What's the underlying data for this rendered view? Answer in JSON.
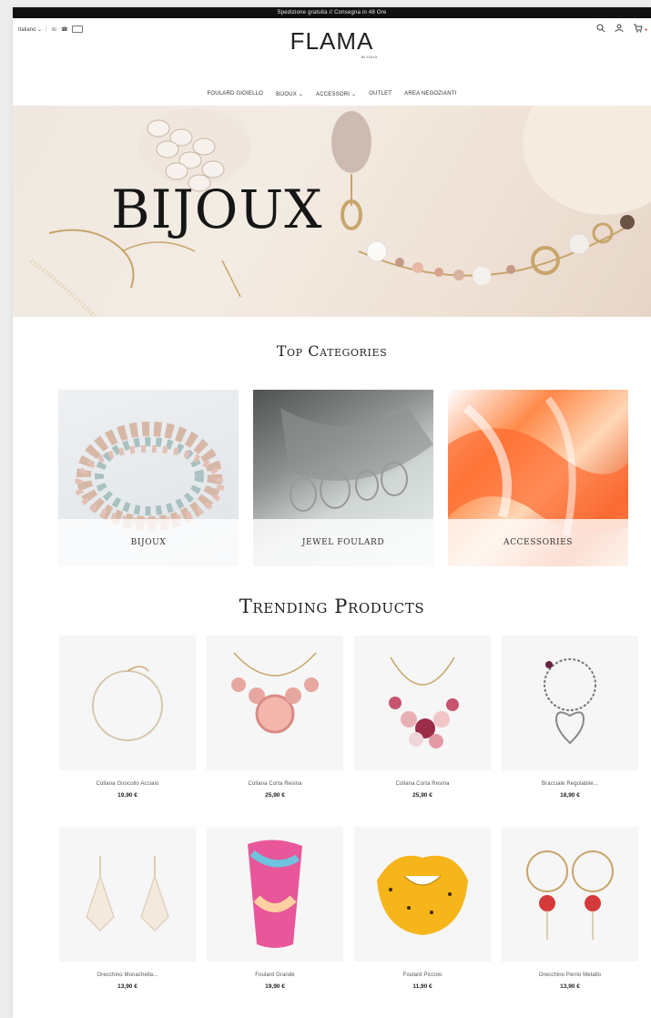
{
  "announcement": "Spedizione gratuita // Consegna in 48 Ore",
  "topbar": {
    "language": "Italiano ⌄"
  },
  "logo": {
    "main": "FLAMA",
    "sub": "BIJOUX"
  },
  "nav": [
    {
      "label": "FOULARD GIOIELLO"
    },
    {
      "label": "BIJOUX ⌄"
    },
    {
      "label": "ACCESSORI ⌄"
    },
    {
      "label": "OUTLET"
    },
    {
      "label": "AREA NEGOZIANTI"
    }
  ],
  "hero": {
    "title": "BIJOUX"
  },
  "sections": {
    "top_categories": "Top Categories",
    "trending": "Trending Products"
  },
  "categories": [
    {
      "label": "BIJOUX"
    },
    {
      "label": "JEWEL FOULARD"
    },
    {
      "label": "ACCESSORIES"
    }
  ],
  "products": [
    {
      "name": "Collana Girocollo Acciaio",
      "price": "19,90 €"
    },
    {
      "name": "Collana Corta Resina",
      "price": "25,90 €"
    },
    {
      "name": "Collana Corta Resina",
      "price": "25,90 €"
    },
    {
      "name": "Bracciale Regolabile...",
      "price": "18,90 €"
    },
    {
      "name": "Orecchino Monachella...",
      "price": "13,90 €"
    },
    {
      "name": "Foulard Grande",
      "price": "19,90 €"
    },
    {
      "name": "Foulard Piccolo",
      "price": "11,90 €"
    },
    {
      "name": "Orecchino Perno Metallo",
      "price": "13,90 €"
    }
  ],
  "icons": {
    "search": "search-icon",
    "account": "user-icon",
    "cart": "cart-icon"
  }
}
